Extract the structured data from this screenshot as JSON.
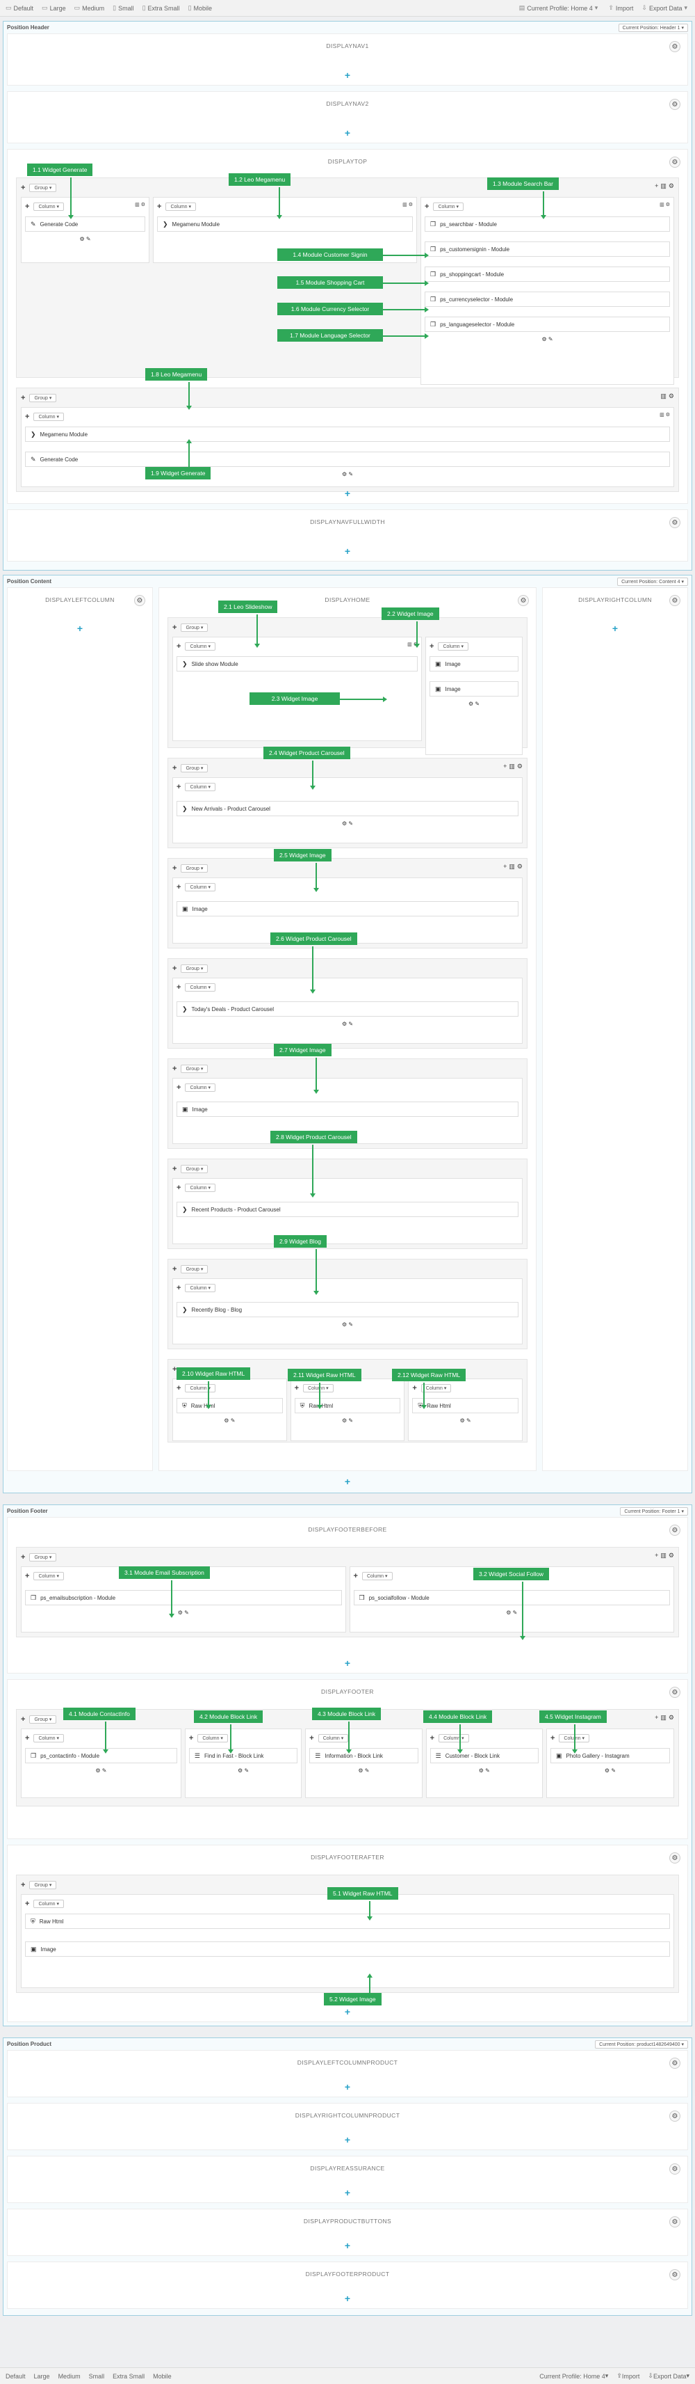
{
  "toolbar": {
    "views": [
      "Default",
      "Large",
      "Medium",
      "Small",
      "Extra Small",
      "Mobile"
    ],
    "profile": "Current Profile: Home 4",
    "import": "Import",
    "export": "Export Data"
  },
  "labels": {
    "group": "Group",
    "column": "Column"
  },
  "header": {
    "title": "Position Header",
    "select": "Current Position: Header 1",
    "hooks": {
      "nav1": "DISPLAYNAV1",
      "nav2": "DISPLAYNAV2",
      "top": "DISPLAYTOP",
      "navfull": "DISPLAYNAVFULLWIDTH"
    },
    "modules": {
      "generate": "Generate Code",
      "megamenu": "Megamenu Module",
      "search": "ps_searchbar - Module",
      "signin": "ps_customersignin - Module",
      "cart": "ps_shoppingcart - Module",
      "currency": "ps_currencyselector - Module",
      "language": "ps_languageselector - Module",
      "megamenu2": "Megamenu Module",
      "generate2": "Generate Code"
    },
    "callouts": {
      "c11": "1.1 Widget Generate",
      "c12": "1.2 Leo Megamenu",
      "c13": "1.3 Module Search Bar",
      "c14": "1.4 Module Customer Signin",
      "c15": "1.5 Module Shopping Cart",
      "c16": "1.6 Module Currency Selector",
      "c17": "1.7 Module Language Selector",
      "c18": "1.8 Leo Megamenu",
      "c19": "1.9 Widget Generate"
    }
  },
  "content": {
    "title": "Position Content",
    "select": "Current Position: Content 4",
    "hooks": {
      "left": "DISPLAYLEFTCOLUMN",
      "home": "DISPLAYHOME",
      "right": "DISPLAYRIGHTCOLUMN"
    },
    "modules": {
      "slideshow": "Slide show Module",
      "image1": "Image",
      "image2": "Image",
      "newarrivals": "New Arrivals - Product Carousel",
      "image3": "Image",
      "todays": "Today's Deals - Product Carousel",
      "image4": "Image",
      "recent": "Recent Products - Product Carousel",
      "blog": "Recently Blog - Blog",
      "raw1": "Raw Html",
      "raw2": "Raw Html",
      "raw3": "Raw Html"
    },
    "callouts": {
      "c21": "2.1 Leo Slideshow",
      "c22": "2.2 Widget Image",
      "c23": "2.3 Widget Image",
      "c24": "2.4 Widget Product Carousel",
      "c25": "2.5 Widget Image",
      "c26": "2.6 Widget Product Carousel",
      "c27": "2.7 Widget Image",
      "c28": "2.8 Widget Product Carousel",
      "c29": "2.9 Widget Blog",
      "c210": "2.10 Widget Raw HTML",
      "c211": "2.11 Widget Raw HTML",
      "c212": "2.12 Widget Raw HTML"
    }
  },
  "footer": {
    "title": "Position Footer",
    "select": "Current Position: Footer 1",
    "hooks": {
      "before": "DISPLAYFOOTERBEFORE",
      "footer": "DISPLAYFOOTER",
      "after": "DISPLAYFOOTERAFTER"
    },
    "modules": {
      "email": "ps_emailsubscription - Module",
      "social": "ps_socialfollow - Module",
      "contact": "ps_contactinfo - Module",
      "find": "Find in Fast - Block Link",
      "info": "Information - Block Link",
      "customer": "Customer - Block Link",
      "gallery": "Photo Gallery - Instagram",
      "raw": "Raw Html",
      "image": "Image"
    },
    "callouts": {
      "c31": "3.1 Module Email Subscription",
      "c32": "3.2 Widget Social Follow",
      "c41": "4.1 Module ContactInfo",
      "c42": "4.2 Module Block Link",
      "c43": "4.3 Module Block Link",
      "c44": "4.4 Module Block Link",
      "c45": "4.5 Widget Instagram",
      "c51": "5.1 Widget Raw HTML",
      "c52": "5.2 Widget Image"
    }
  },
  "product": {
    "title": "Position Product",
    "select": "Current Position: product1482649400",
    "hooks": {
      "leftp": "DISPLAYLEFTCOLUMNPRODUCT",
      "rightp": "DISPLAYRIGHTCOLUMNPRODUCT",
      "reassurance": "DISPLAYREASSURANCE",
      "buttons": "DISPLAYPRODUCTBUTTONS",
      "footerp": "DISPLAYFOOTERPRODUCT"
    }
  }
}
